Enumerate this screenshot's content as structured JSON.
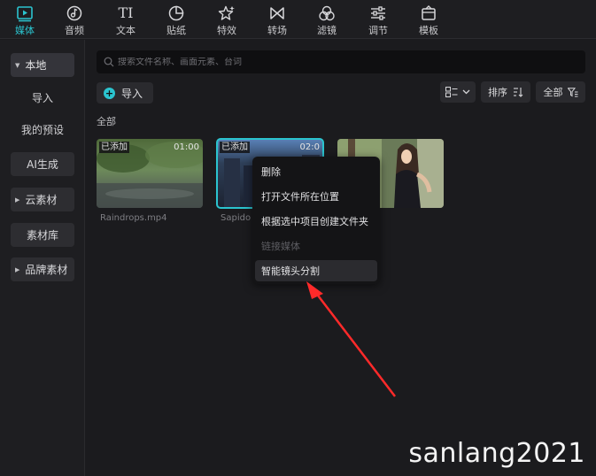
{
  "toolbar": {
    "items": [
      {
        "label": "媒体",
        "icon": "media-icon",
        "active": true
      },
      {
        "label": "音频",
        "icon": "audio-icon"
      },
      {
        "label": "文本",
        "icon": "text-icon"
      },
      {
        "label": "贴纸",
        "icon": "sticker-icon"
      },
      {
        "label": "特效",
        "icon": "effects-icon"
      },
      {
        "label": "转场",
        "icon": "transition-icon"
      },
      {
        "label": "滤镜",
        "icon": "filter-icon"
      },
      {
        "label": "调节",
        "icon": "adjust-icon"
      },
      {
        "label": "模板",
        "icon": "template-icon"
      }
    ],
    "text_icon_glyph": "TI",
    "accent": "#2bc4cf"
  },
  "sidebar": {
    "local": "本地",
    "import": "导入",
    "presets": "我的预设",
    "ai": "AI生成",
    "cloud": "云素材",
    "library": "素材库",
    "brand": "品牌素材"
  },
  "main": {
    "search_placeholder": "搜索文件名称、画面元素、台词",
    "import_label": "导入",
    "sort_label": "排序",
    "filter_label": "全部",
    "section_title": "全部",
    "media": [
      {
        "badge": "已添加",
        "duration": "01:00",
        "filename": "Raindrops.mp4"
      },
      {
        "badge": "已添加",
        "duration": "02:0",
        "filename": "Sapido"
      },
      {
        "badge": "",
        "duration": "",
        "filename": ""
      }
    ]
  },
  "context_menu": {
    "items": [
      {
        "label": "删除"
      },
      {
        "label": "打开文件所在位置"
      },
      {
        "label": "根据选中项目创建文件夹"
      },
      {
        "label": "链接媒体",
        "disabled": true
      },
      {
        "label": "智能镜头分割",
        "hover": true
      }
    ]
  },
  "watermark": "sanlang2021",
  "arrow_color": "#ff2a2a"
}
